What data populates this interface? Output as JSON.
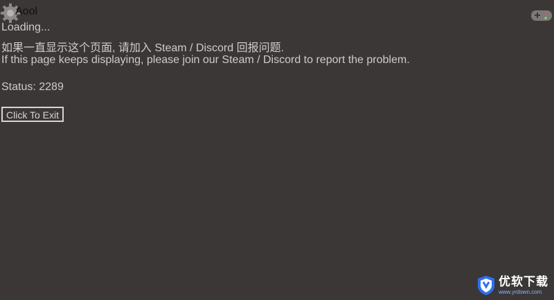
{
  "window": {
    "title": "Aool",
    "gear_icon": "gear-icon",
    "gamepad_icon": "gamepad-icon"
  },
  "content": {
    "loading": "Loading...",
    "message_cn": "如果一直显示这个页面, 请加入 Steam / Discord 回报问题.",
    "message_en": "If this page keeps displaying, please join our Steam / Discord to report the problem.",
    "status": "Status: 2289",
    "exit_label": "Click To Exit"
  },
  "watermark": {
    "name": "优软下载",
    "url": "www.yrdown.com",
    "logo_icon": "shield-logo-icon"
  },
  "colors": {
    "background": "#3a3736",
    "text": "#cfcccb",
    "watermark_accent": "#2f6ff0"
  }
}
